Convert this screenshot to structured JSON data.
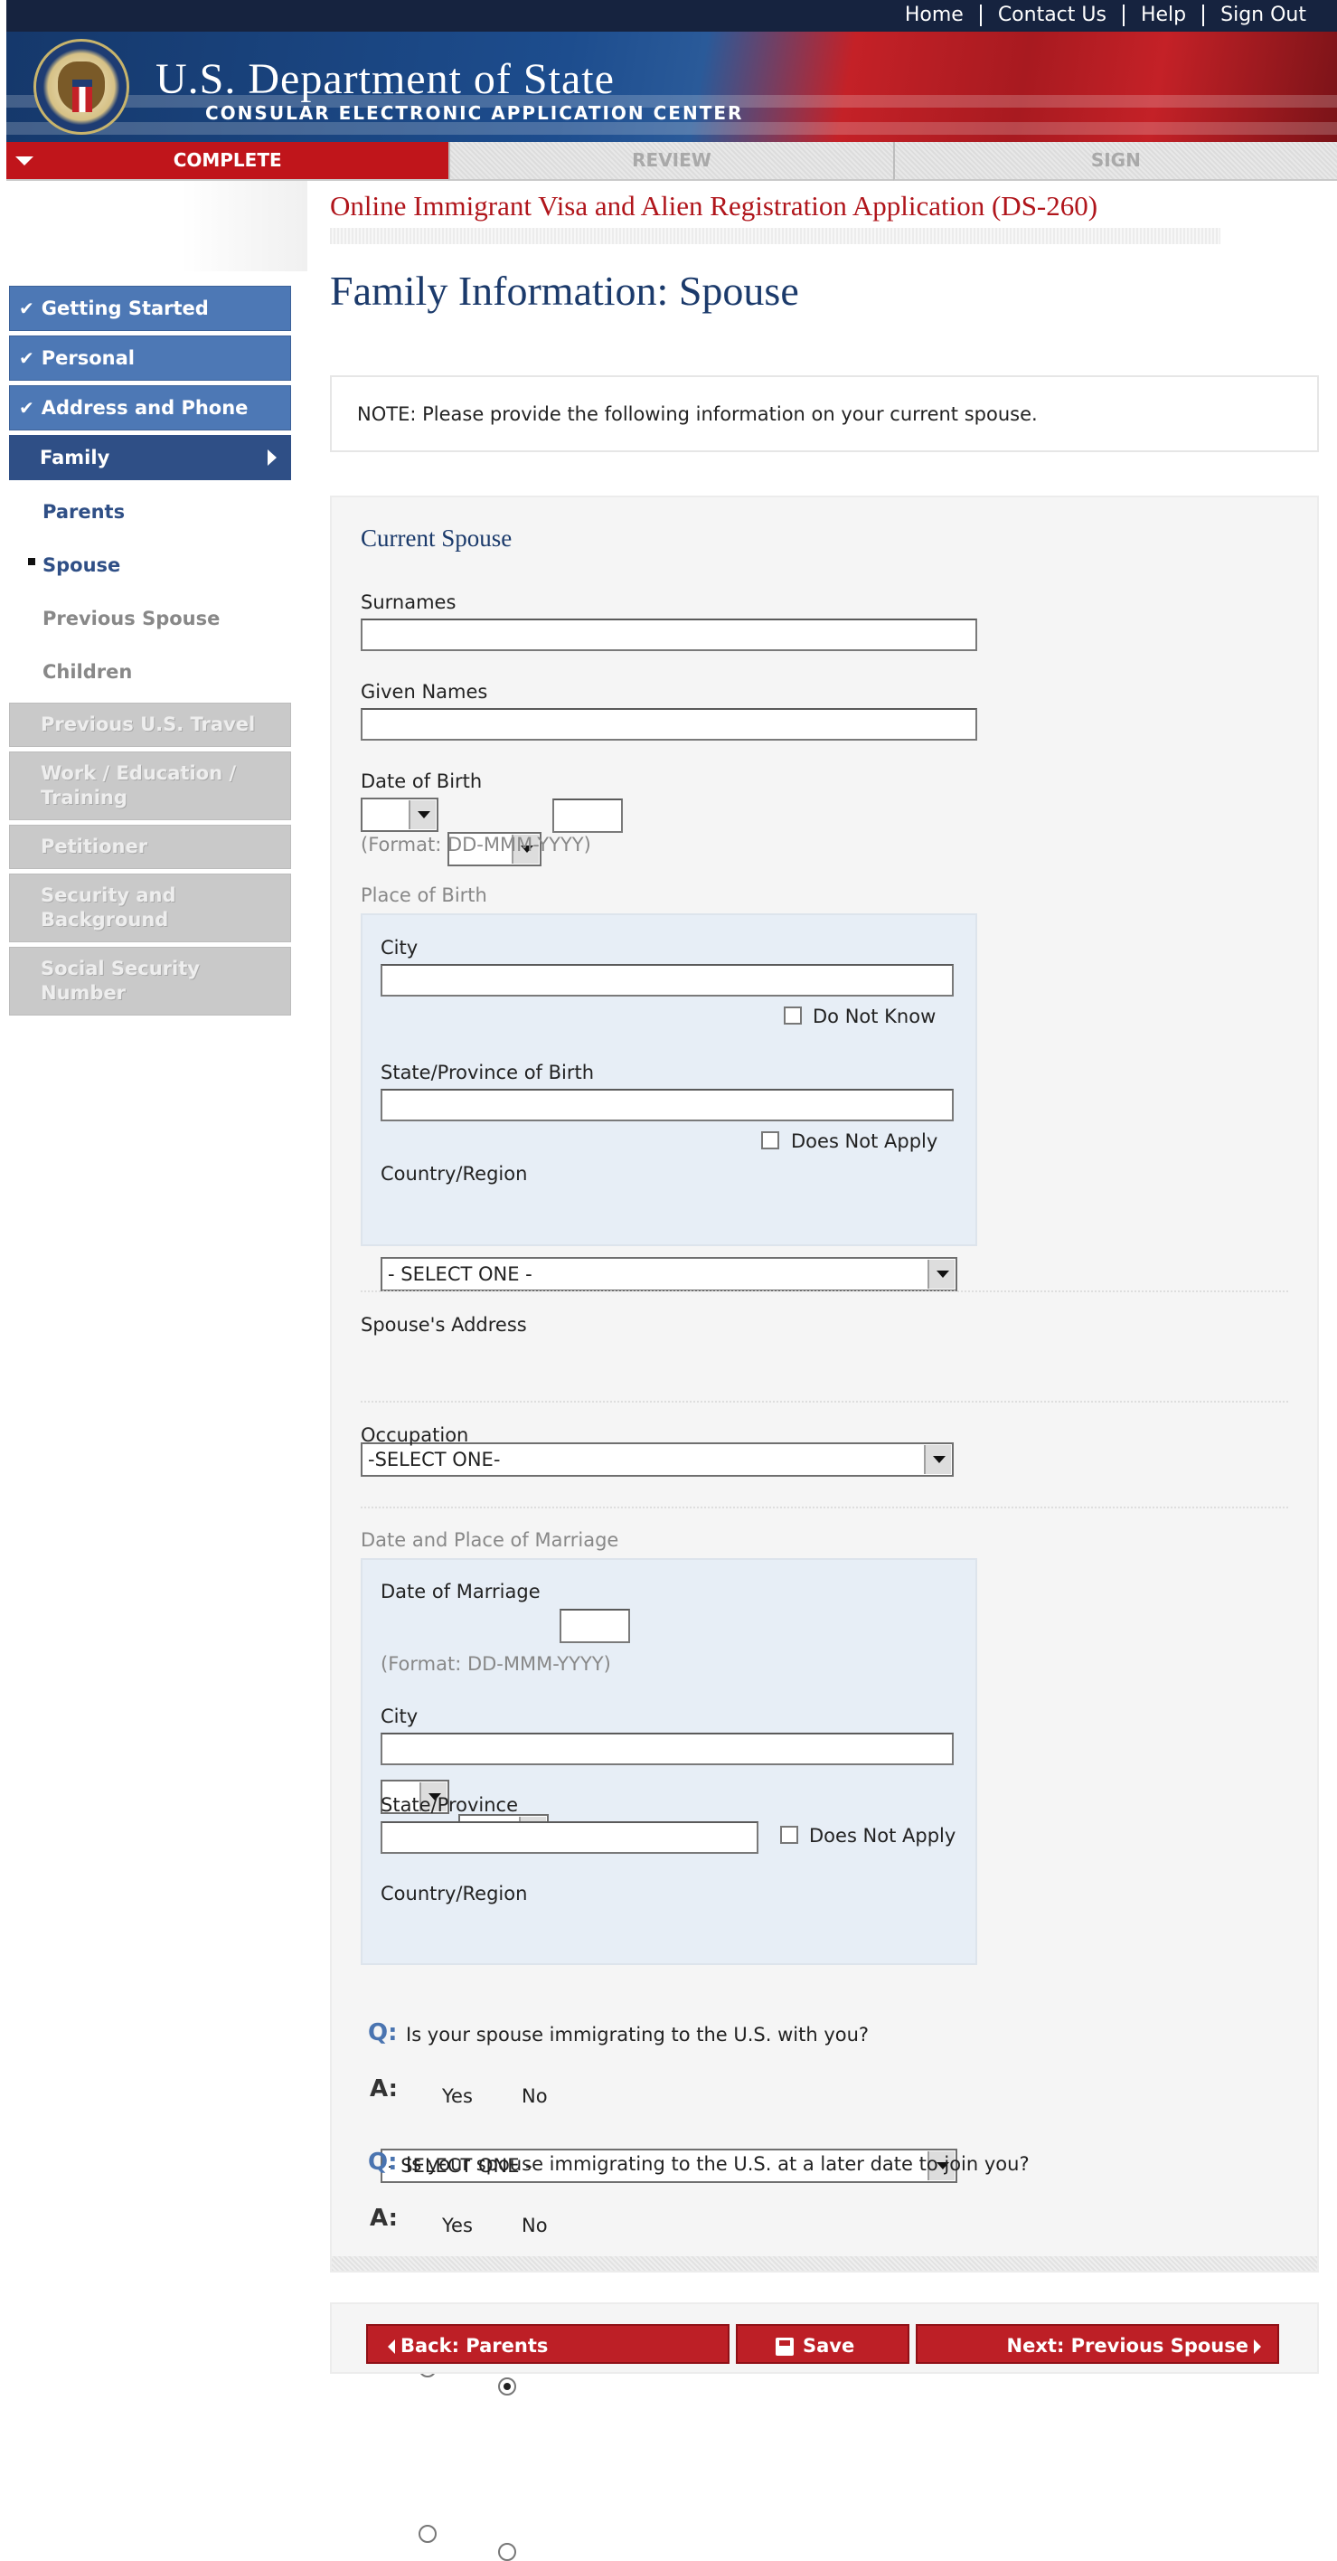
{
  "header": {
    "top_links": [
      "Home",
      "Contact Us",
      "Help",
      "Sign Out"
    ],
    "department_title": "U.S. Department of State",
    "department_subtitle": "CONSULAR ELECTRONIC APPLICATION CENTER"
  },
  "steps": {
    "complete": "COMPLETE",
    "review": "REVIEW",
    "sign": "SIGN"
  },
  "application_title": "Online Immigrant Visa and Alien Registration Application (DS-260)",
  "page_title": "Family Information: Spouse",
  "sidebar": {
    "completed": [
      "Getting Started",
      "Personal",
      "Address and Phone"
    ],
    "current_section": "Family",
    "sub_items": {
      "parents": "Parents",
      "spouse": "Spouse",
      "previous_spouse": "Previous Spouse",
      "children": "Children"
    },
    "disabled": [
      "Previous U.S. Travel",
      "Work / Education / Training",
      "Petitioner",
      "Security and Background",
      "Social Security Number"
    ]
  },
  "note": "NOTE: Please provide the following information on your current spouse.",
  "form": {
    "current_spouse_title": "Current Spouse",
    "surnames_label": "Surnames",
    "given_names_label": "Given Names",
    "dob_label": "Date of Birth",
    "date_format": "(Format: DD-MMM-YYYY)",
    "place_of_birth_label": "Place of Birth",
    "city_label": "City",
    "do_not_know": "Do Not Know",
    "state_province_birth_label": "State/Province of Birth",
    "does_not_apply": "Does Not Apply",
    "country_region_label": "Country/Region",
    "select_one_spaced": "- SELECT ONE -",
    "spouse_address_label": "Spouse's Address",
    "select_one": "-SELECT ONE-",
    "occupation_label": "Occupation",
    "marriage_section_label": "Date and Place of Marriage",
    "date_of_marriage_label": "Date of Marriage",
    "state_province_label": "State/Province",
    "q_marker": "Q:",
    "a_marker": "A:",
    "question1": "Is your spouse immigrating to the U.S. with you?",
    "question2": "Is your spouse immigrating to the U.S. at a later date to join you?",
    "yes": "Yes",
    "no": "No",
    "answer1": "No",
    "answer2": null
  },
  "footer": {
    "back": "Back: Parents",
    "save": "Save",
    "next": "Next: Previous Spouse"
  },
  "colors": {
    "accent_red": "#c0151b",
    "nav_blue": "#4d78b5",
    "title_blue": "#1b3a6b"
  }
}
